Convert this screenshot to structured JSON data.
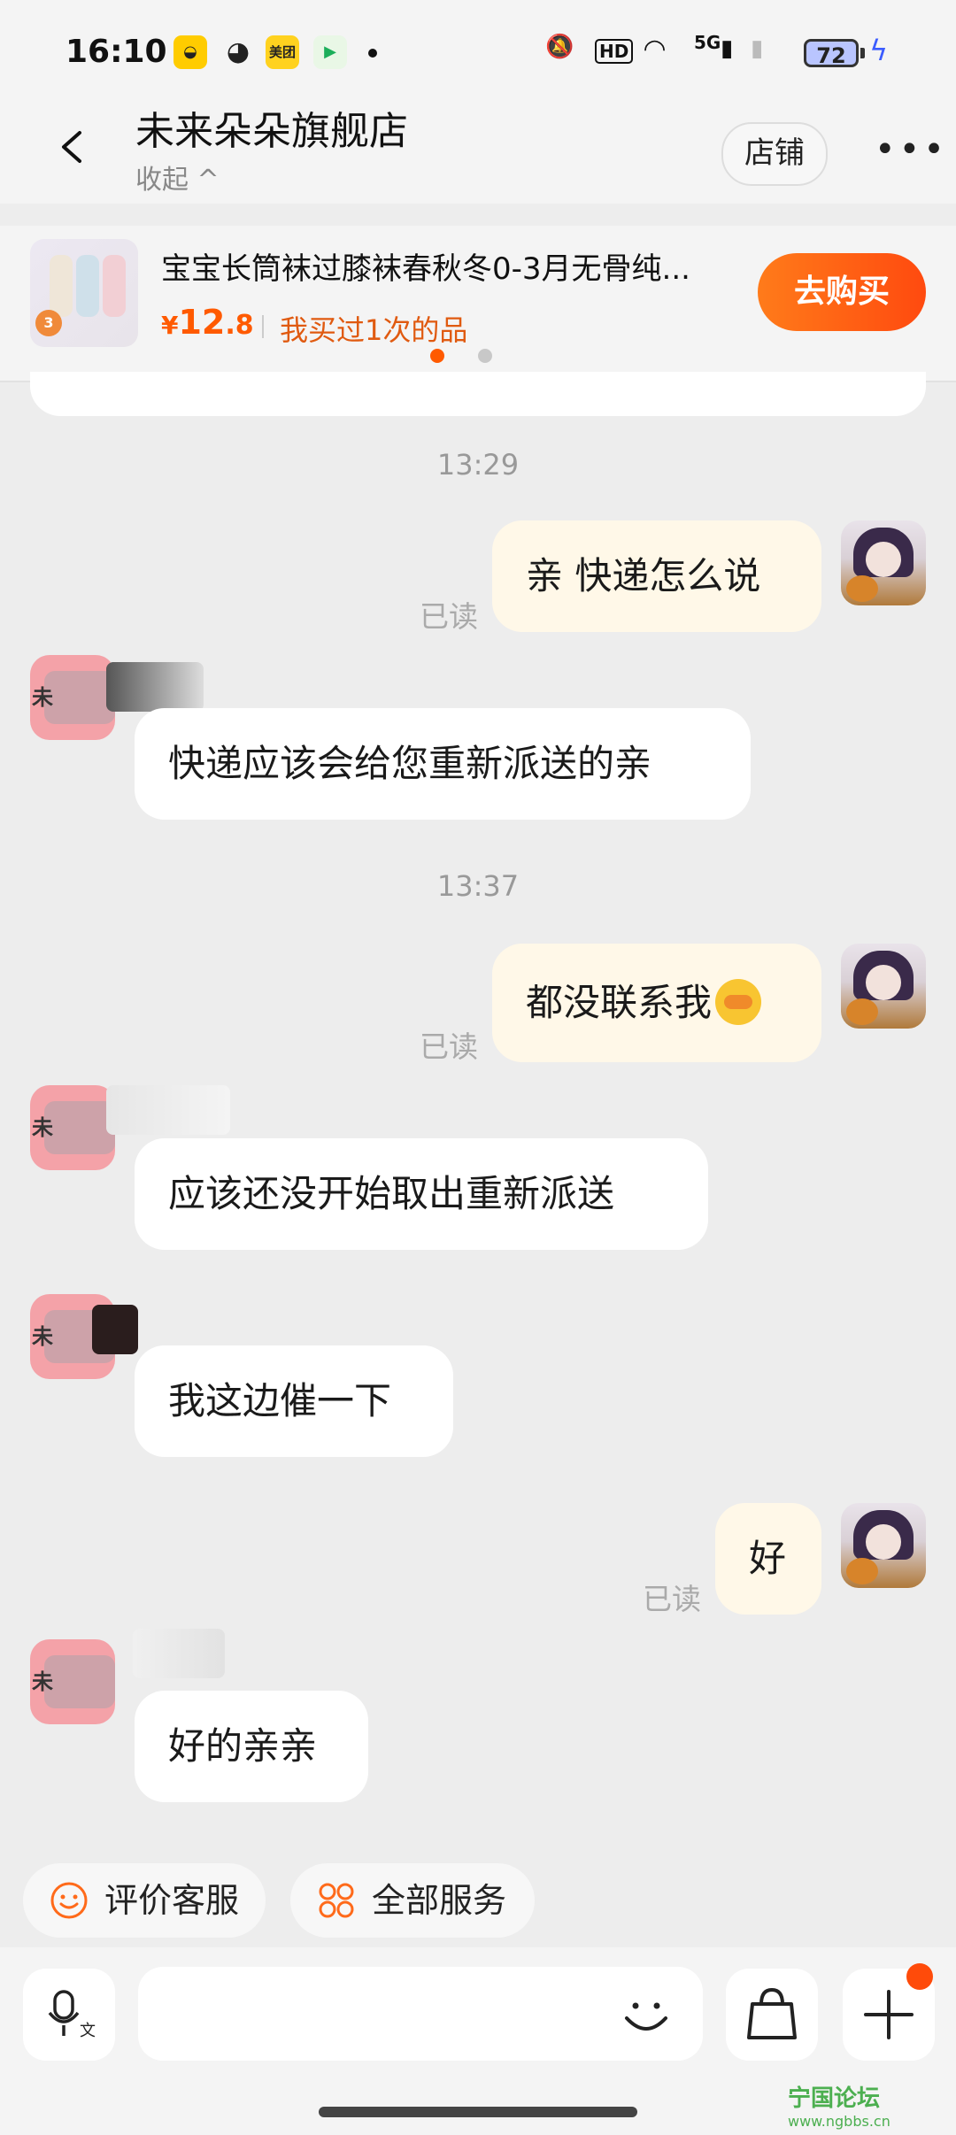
{
  "status_bar": {
    "time": "16:10",
    "apps": [
      "美团"
    ],
    "network": "5G",
    "battery": "72"
  },
  "header": {
    "store_name": "未来朵朵旗舰店",
    "collapse_label": "收起 ^",
    "shop_button": "店铺",
    "more_icon": "more-icon"
  },
  "product": {
    "title": "宝宝长筒袜过膝袜春秋冬0-3月无骨纯...",
    "price_symbol": "¥",
    "price_int": "12",
    "price_dec": ".8",
    "bought_text": "我买过1次的品",
    "buy_button": "去购买",
    "badge": "3"
  },
  "chat": {
    "messages": [
      {
        "type": "time",
        "text": "13:29"
      },
      {
        "type": "me",
        "text": "亲 快递怎么说",
        "read": "已读"
      },
      {
        "type": "them",
        "text": "快递应该会给您重新派送的亲"
      },
      {
        "type": "time",
        "text": "13:37"
      },
      {
        "type": "me",
        "text": "都没联系我",
        "read": "已读"
      },
      {
        "type": "them",
        "text": "应该还没开始取出重新派送"
      },
      {
        "type": "them",
        "text": "我这边催一下"
      },
      {
        "type": "me",
        "text": "好",
        "read": "已读"
      },
      {
        "type": "them",
        "text": "好的亲亲"
      }
    ],
    "avatar_char": "未"
  },
  "quick_actions": [
    {
      "label": "评价客服",
      "icon": "smile-icon"
    },
    {
      "label": "全部服务",
      "icon": "grid-icon"
    }
  ],
  "input_bar": {
    "mic_icon": "voice-input-icon",
    "emoji_icon": "emoji-icon",
    "bag_icon": "shopping-bag-icon",
    "plus_icon": "plus-icon"
  },
  "watermark": {
    "title": "宁国论坛",
    "url": "www.ngbbs.cn"
  },
  "colors": {
    "accent": "#ff5a00",
    "my_bubble": "#fff8e8",
    "their_bubble": "#ffffff",
    "background": "#ededed"
  }
}
